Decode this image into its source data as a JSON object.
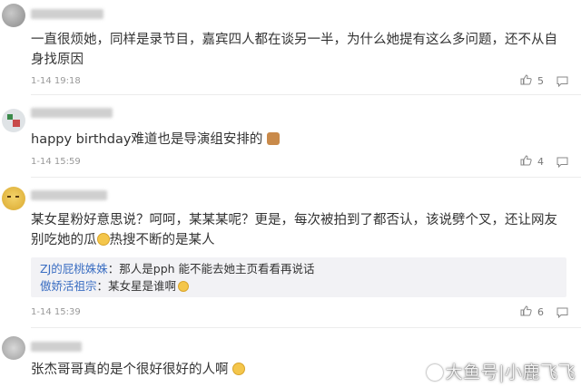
{
  "comments": [
    {
      "text": "一直很烦她，同样是录节目，嘉宾四人都在谈另一半，为什么她提有这么多问题，还不从自身找原因",
      "time": "1-14 19:18",
      "likes": "5"
    },
    {
      "text": "happy birthday难道也是导演组安排的",
      "time": "1-14 15:59",
      "likes": "4"
    },
    {
      "text": "某女星粉好意思说？呵呵，某某某呢？更是，每次被拍到了都否认，该说劈个叉，还让网友别吃她的瓜",
      "text_tail": "热搜不断的是某人",
      "time": "1-14 15:39",
      "likes": "6",
      "replies": [
        {
          "name": "ZJ的屁桃姝姝",
          "sep": "：",
          "text": "那人是pph 能不能去她主页看看再说话"
        },
        {
          "name": "傲娇活祖宗",
          "sep": "：",
          "text": "某女星是谁啊"
        }
      ]
    },
    {
      "text": "张杰哥哥真的是个很好很好的人啊"
    }
  ],
  "watermark": "大鱼号|小鹿飞飞",
  "colors": {
    "link": "#3b6ec2",
    "time": "#999999",
    "reply_bg": "#f2f2f5"
  },
  "icons": {
    "like": "thumb-up-icon",
    "reply": "comment-icon"
  }
}
